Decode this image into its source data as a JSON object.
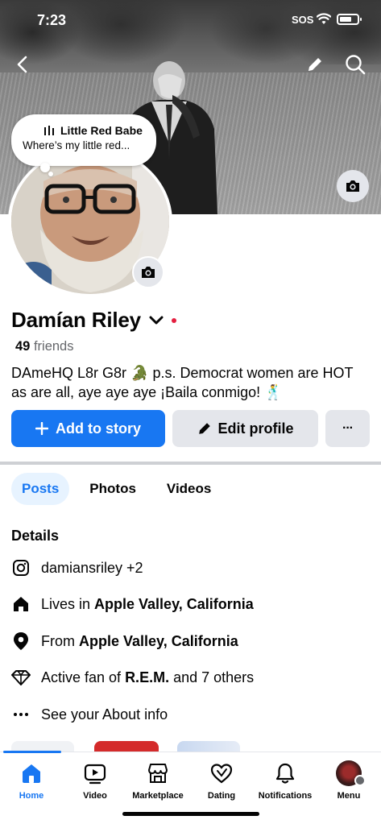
{
  "status_bar": {
    "time": "7:23",
    "sos": "SOS"
  },
  "music": {
    "title": "Little Red Babe",
    "subtitle": "Where’s my little red..."
  },
  "profile": {
    "name": "Damían Riley",
    "friends_count": "49",
    "friends_label": "friends",
    "bio": "DAmeHQ L8r G8r 🐊 p.s. Democrat women are HOT as are all, aye aye aye ¡Baila conmigo! 🕺"
  },
  "actions": {
    "add_story": "Add to story",
    "edit_profile": "Edit profile",
    "more": "···"
  },
  "tabs": [
    "Posts",
    "Photos",
    "Videos"
  ],
  "details": {
    "title": "Details",
    "instagram": "damiansriley +2",
    "lives_prefix": "Lives in",
    "lives_place": "Apple Valley, California",
    "from_prefix": "From",
    "from_place": "Apple Valley, California",
    "fan_prefix": "Active fan of",
    "fan_name": "R.E.M.",
    "fan_suffix": "and 7 others",
    "about": "See your About info"
  },
  "nav": [
    "Home",
    "Video",
    "Marketplace",
    "Dating",
    "Notifications",
    "Menu"
  ],
  "colors": {
    "accent": "#1877f2",
    "tab_active_bg": "#e7f3ff",
    "button_gray": "#e4e6eb",
    "presence_dot": "#e41e3f"
  }
}
